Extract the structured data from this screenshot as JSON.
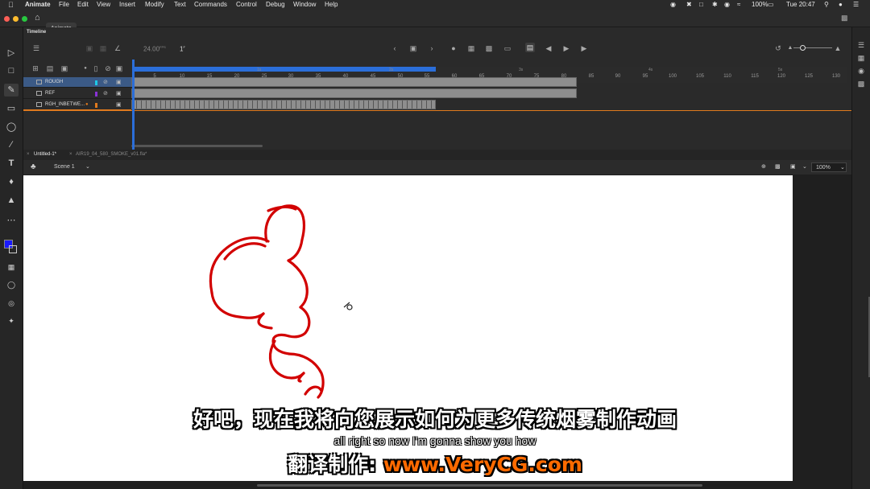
{
  "menubar": {
    "app": "Animate",
    "items": [
      "File",
      "Edit",
      "View",
      "Insert",
      "Modify",
      "Text",
      "Commands",
      "Control",
      "Debug",
      "Window",
      "Help"
    ],
    "battery": "100%",
    "clock": "Tue 20:47"
  },
  "titlebar": {
    "tab": "Animate"
  },
  "timeline": {
    "title": "Timeline",
    "fps": "24.00",
    "fps_unit": "FPS",
    "frame": "1",
    "frame_unit": "F",
    "layers": [
      {
        "name": "ROUGH",
        "color": "#1ec8e6",
        "selected": true
      },
      {
        "name": "REF",
        "color": "#8a32d6",
        "selected": false
      },
      {
        "name": "RGH_INBETWE...",
        "color": "#e07a1e",
        "selected": false
      }
    ],
    "frame_numbers": [
      "5",
      "10",
      "15",
      "20",
      "25",
      "30",
      "35",
      "40",
      "45",
      "50",
      "55",
      "60",
      "65",
      "70",
      "75",
      "80",
      "85",
      "90",
      "95",
      "100",
      "105",
      "110",
      "115",
      "120",
      "125",
      "130"
    ],
    "second_marks": [
      "1s",
      "2s",
      "3s",
      "4s",
      "5s"
    ]
  },
  "documents": {
    "tabs": [
      "Untitled-1*",
      "AIR19_04_580_SMOKE_v01.fla*"
    ],
    "scene": "Scene 1",
    "zoom": "100%"
  },
  "subtitles": {
    "chinese": "好吧，现在我将向您展示如何为更多传统烟雾制作动画",
    "english": "all right so now I'm gonna show you how",
    "watermark_prefix": "翻译制作: ",
    "watermark_url": "www.VeryCG.com"
  },
  "colors": {
    "accent": "#2b6ed9",
    "stroke": "#d20000",
    "fill_swatch": "#1a1aff",
    "watermark": "#ff6a00"
  }
}
